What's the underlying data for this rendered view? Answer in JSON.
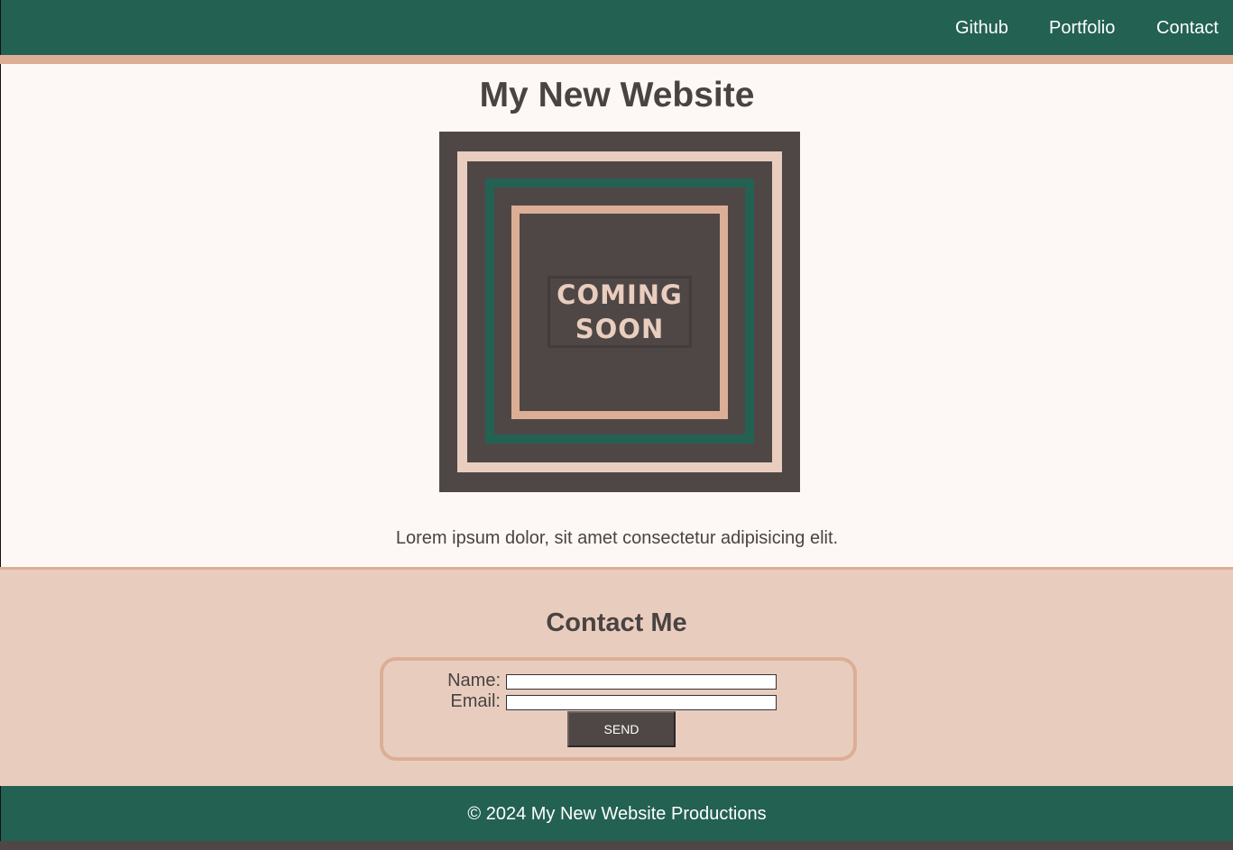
{
  "nav": {
    "links": [
      {
        "label": "Github"
      },
      {
        "label": "Portfolio"
      },
      {
        "label": "Contact"
      }
    ]
  },
  "main": {
    "title": "My New Website",
    "poster": {
      "line1": "COMING",
      "line2": "SOON"
    },
    "description": "Lorem ipsum dolor, sit amet consectetur adipisicing elit."
  },
  "contact": {
    "title": "Contact Me",
    "name_label": "Name:",
    "name_value": "",
    "email_label": "Email:",
    "email_value": "",
    "send_label": "Send"
  },
  "footer": {
    "text": "© 2024 My New Website Productions"
  },
  "colors": {
    "green": "#236152",
    "peach": "#dcae96",
    "light_peach": "#e8cdbf",
    "dark_brown": "#4f4745",
    "cream": "#fdf8f5"
  }
}
